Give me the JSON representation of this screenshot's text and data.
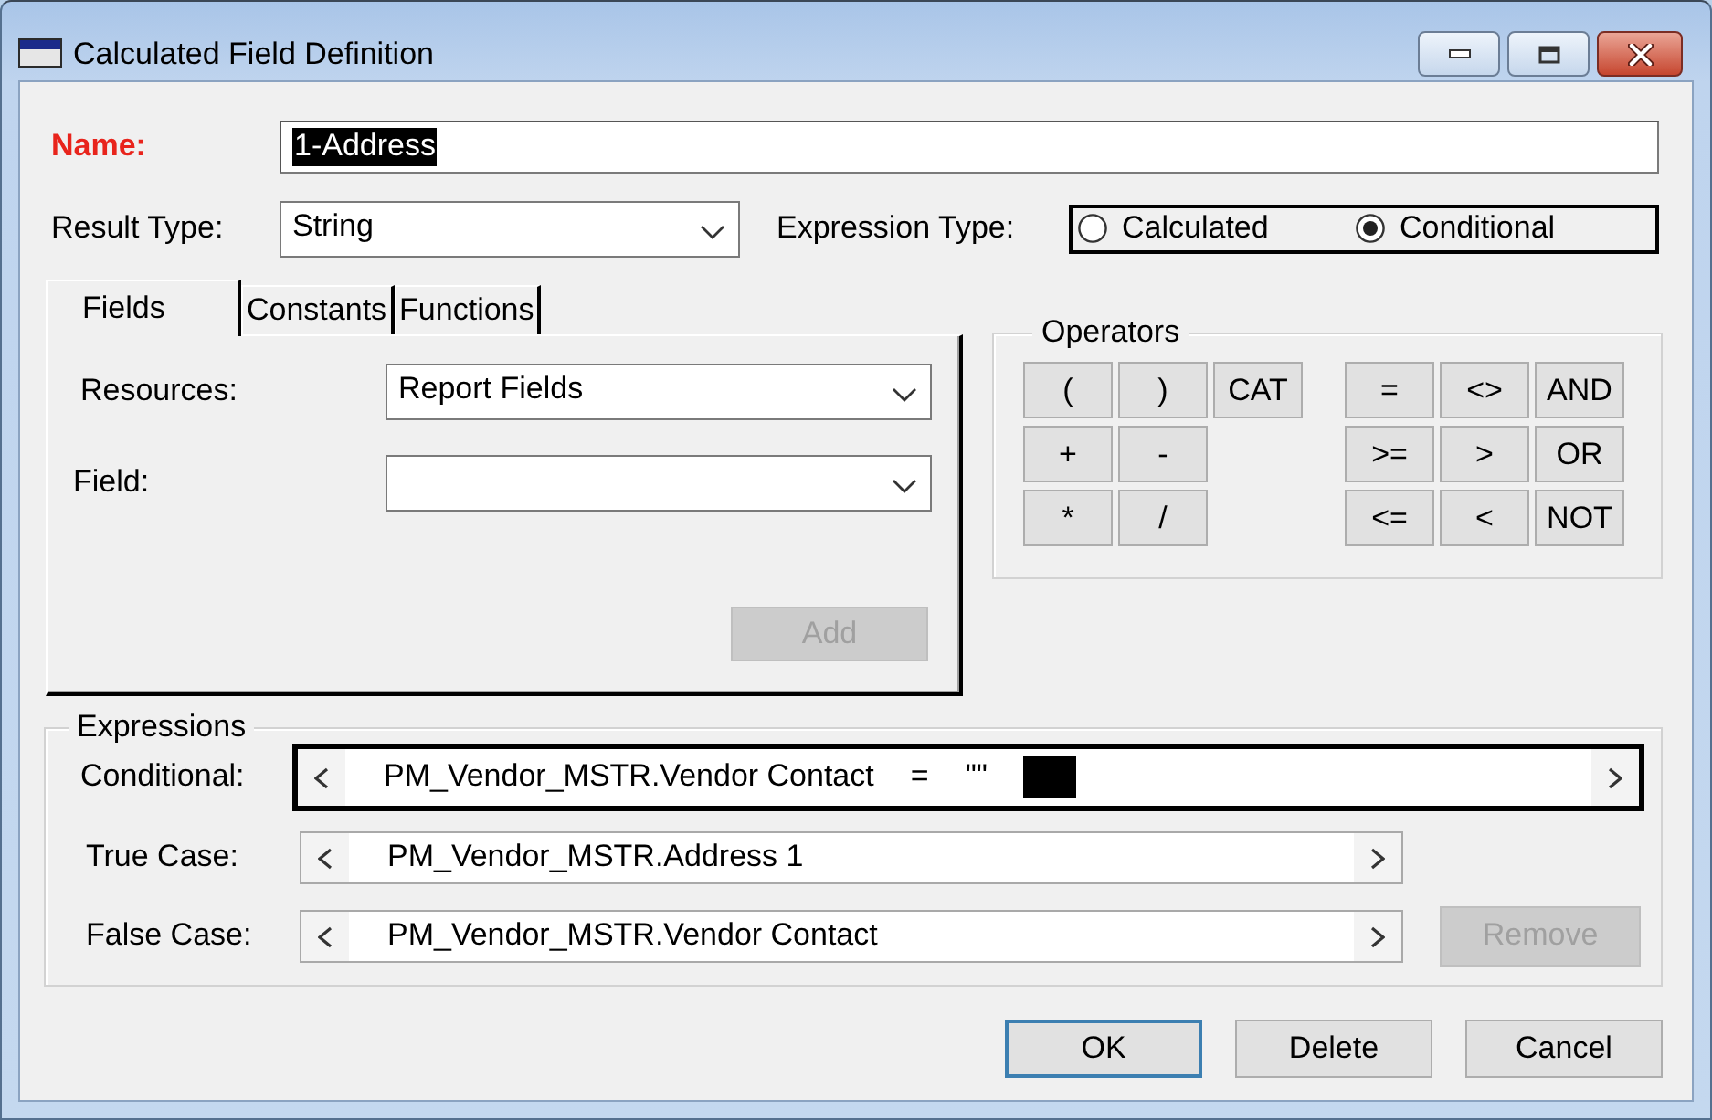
{
  "window": {
    "title": "Calculated Field Definition"
  },
  "name": {
    "label": "Name:",
    "value": "1-Address",
    "selected": true
  },
  "result_type": {
    "label": "Result Type:",
    "value": "String"
  },
  "expression_type": {
    "label": "Expression Type:",
    "options": [
      {
        "label": "Calculated",
        "selected": false
      },
      {
        "label": "Conditional",
        "selected": true
      }
    ]
  },
  "tabs": [
    {
      "label": "Fields",
      "selected": true
    },
    {
      "label": "Constants",
      "selected": false
    },
    {
      "label": "Functions",
      "selected": false
    }
  ],
  "fields_tab": {
    "resources": {
      "label": "Resources:",
      "value": "Report Fields"
    },
    "field": {
      "label": "Field:"
    },
    "add_button": {
      "label": "Add",
      "disabled": true
    }
  },
  "operators": {
    "title": "Operators",
    "groups": [
      [
        [
          "(",
          ")",
          "CAT"
        ],
        [
          "+",
          "-"
        ],
        [
          "*",
          "/"
        ]
      ],
      [
        [
          "=",
          "<>",
          "AND"
        ],
        [
          ">=",
          ">",
          "OR"
        ],
        [
          "<=",
          "<",
          "NOT"
        ]
      ]
    ]
  },
  "expressions": {
    "title": "Expressions",
    "rows": [
      {
        "label": "Conditional:",
        "focused": true,
        "tokens": [
          "PM_Vendor_MSTR.Vendor Contact",
          "=",
          "\"\""
        ],
        "selection_block": true
      },
      {
        "label": "True Case:",
        "focused": false,
        "tokens": [
          "PM_Vendor_MSTR.Address 1"
        ],
        "selection_block": false
      },
      {
        "label": "False Case:",
        "focused": false,
        "tokens": [
          "PM_Vendor_MSTR.Vendor Contact"
        ],
        "selection_block": false
      }
    ],
    "remove_button": {
      "label": "Remove",
      "disabled": true
    }
  },
  "buttons": [
    {
      "label": "OK",
      "default": true
    },
    {
      "label": "Delete",
      "default": false
    },
    {
      "label": "Cancel",
      "default": false
    }
  ]
}
